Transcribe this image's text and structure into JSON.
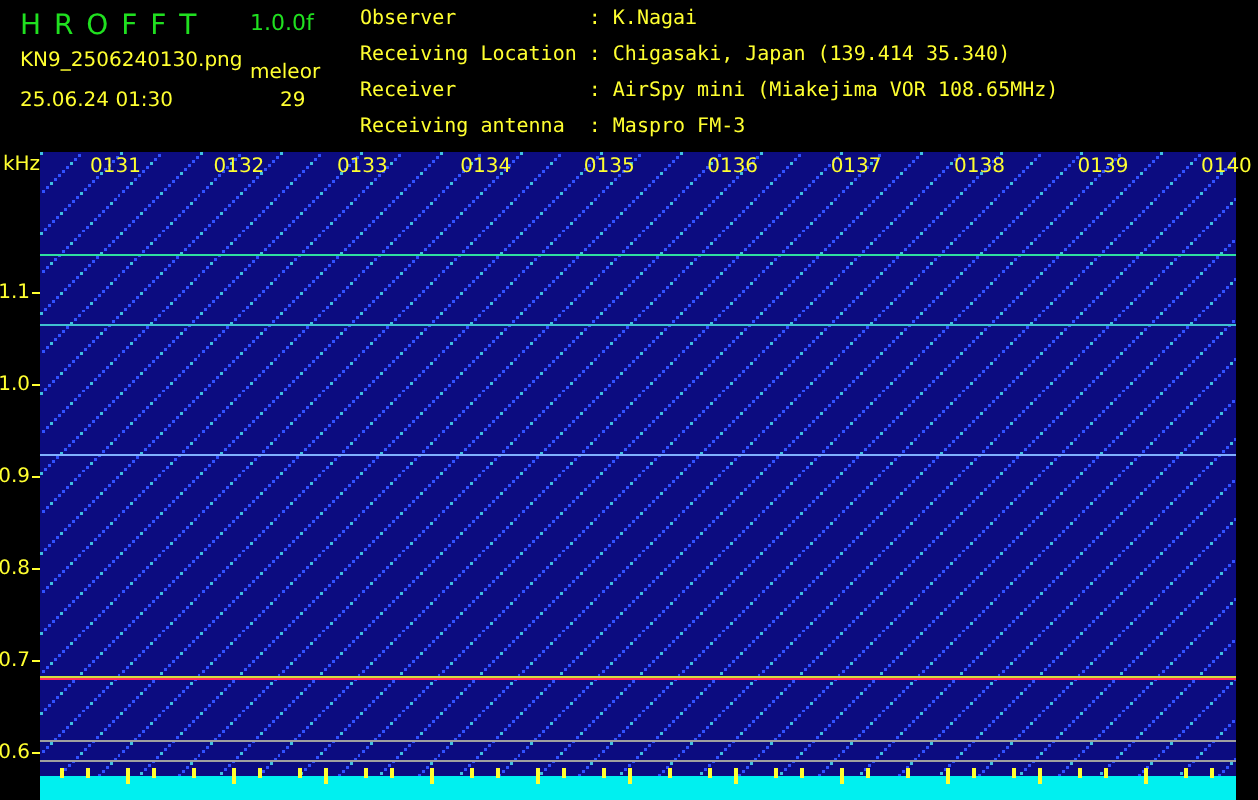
{
  "header": {
    "title": "H R O F F T",
    "version": "1.0.0f",
    "filename": "KN9_2506240130.png",
    "mode": "meleor",
    "timestamp": "25.06.24 01:30",
    "count": "29"
  },
  "info": [
    {
      "label": "Observer",
      "separator": ":",
      "value": "K.Nagai"
    },
    {
      "label": "Receiving Location",
      "separator": ":",
      "value": "Chigasaki, Japan (139.414 35.340)"
    },
    {
      "label": "Receiver",
      "separator": ":",
      "value": "AirSpy mini (Miakejima VOR 108.65MHz)"
    },
    {
      "label": "Receiving antenna",
      "separator": ":",
      "value": "Maspro FM-3"
    }
  ],
  "y_axis": {
    "unit": "kHz",
    "labels": [
      "1.1",
      "1.0",
      "0.9",
      "0.8",
      "0.7",
      "0.6"
    ]
  },
  "time_labels": [
    "0131",
    "0132",
    "0133",
    "0134",
    "0135",
    "0136",
    "0137",
    "0138",
    "0139",
    "0140"
  ]
}
